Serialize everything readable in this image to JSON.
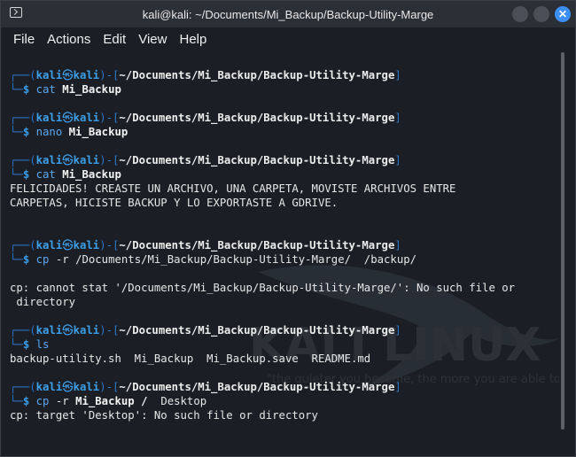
{
  "window": {
    "title": "kali@kali: ~/Documents/Mi_Backup/Backup-Utility-Marge",
    "minimize_label": "",
    "maximize_label": "",
    "close_label": "✕"
  },
  "menu": [
    "File",
    "Actions",
    "Edit",
    "View",
    "Help"
  ],
  "prompt": {
    "open": "┌──(",
    "user": "kali",
    "at": "㉿",
    "host": "kali",
    "mid": ")-[",
    "path": "~/Documents/Mi_Backup/Backup-Utility-Marge",
    "close": "]",
    "corner": "└─",
    "dollar": "$"
  },
  "blocks": [
    {
      "cmd": "cat",
      "args": [
        {
          "t": "Mi_Backup",
          "b": true
        }
      ],
      "output": []
    },
    {
      "cmd": "nano",
      "args": [
        {
          "t": "Mi_Backup",
          "b": true
        }
      ],
      "output": []
    },
    {
      "cmd": "cat",
      "args": [
        {
          "t": "Mi_Backup",
          "b": true
        }
      ],
      "output": [
        "FELICIDADES! CREASTE UN ARCHIVO, UNA CARPETA, MOVISTE ARCHIVOS ENTRE",
        "CARPETAS, HICISTE BACKUP Y LO EXPORTASTE A GDRIVE."
      ]
    },
    {
      "cmd": "cp",
      "args": [
        {
          "t": "-r",
          "b": false
        },
        {
          "t": "/Documents/Mi_Backup/Backup-Utility-Marge/  /backup/",
          "b": false
        }
      ],
      "output": [
        "",
        "cp: cannot stat '/Documents/Mi_Backup/Backup-Utility-Marge/': No such file or",
        " directory"
      ]
    },
    {
      "cmd": "ls",
      "args": [],
      "output": [
        "backup-utility.sh  Mi_Backup  Mi_Backup.save  README.md"
      ]
    },
    {
      "cmd": "cp",
      "args": [
        {
          "t": "-r",
          "b": false
        },
        {
          "t": "Mi_Backup / ",
          "b": true
        },
        {
          "t": "Desktop",
          "b": false
        }
      ],
      "output": [
        "cp: target 'Desktop': No such file or directory"
      ]
    }
  ],
  "watermark": {
    "brand": "KALI LINUX",
    "slogan": "\"the quieter you become, the more you are able to hear\""
  }
}
